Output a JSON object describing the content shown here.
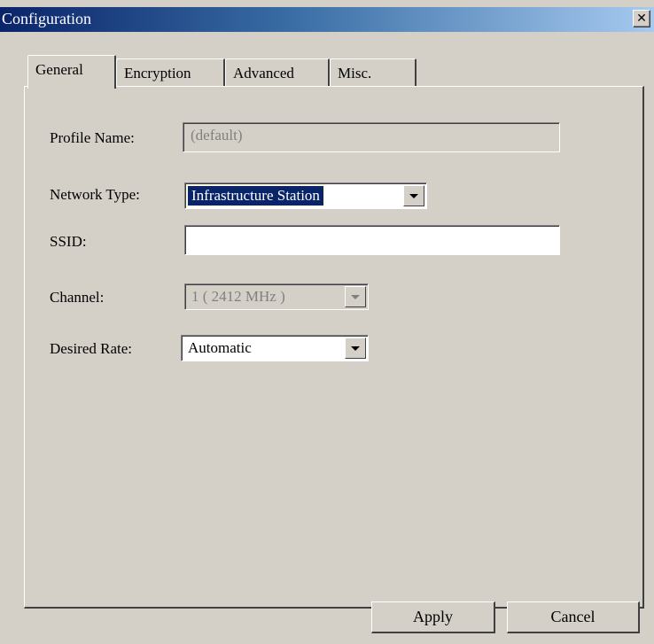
{
  "window": {
    "title": "Configuration"
  },
  "tabs": [
    {
      "label": "General"
    },
    {
      "label": "Encryption"
    },
    {
      "label": "Advanced"
    },
    {
      "label": "Misc."
    }
  ],
  "general": {
    "profile_name": {
      "label": "Profile Name:",
      "value": "(default)"
    },
    "network_type": {
      "label": "Network Type:",
      "value": "Infrastructure Station"
    },
    "ssid": {
      "label": "SSID:",
      "value": ""
    },
    "channel": {
      "label": "Channel:",
      "value": "1 ( 2412 MHz )"
    },
    "desired_rate": {
      "label": "Desired Rate:",
      "value": "Automatic"
    }
  },
  "buttons": {
    "apply": "Apply",
    "cancel": "Cancel"
  }
}
